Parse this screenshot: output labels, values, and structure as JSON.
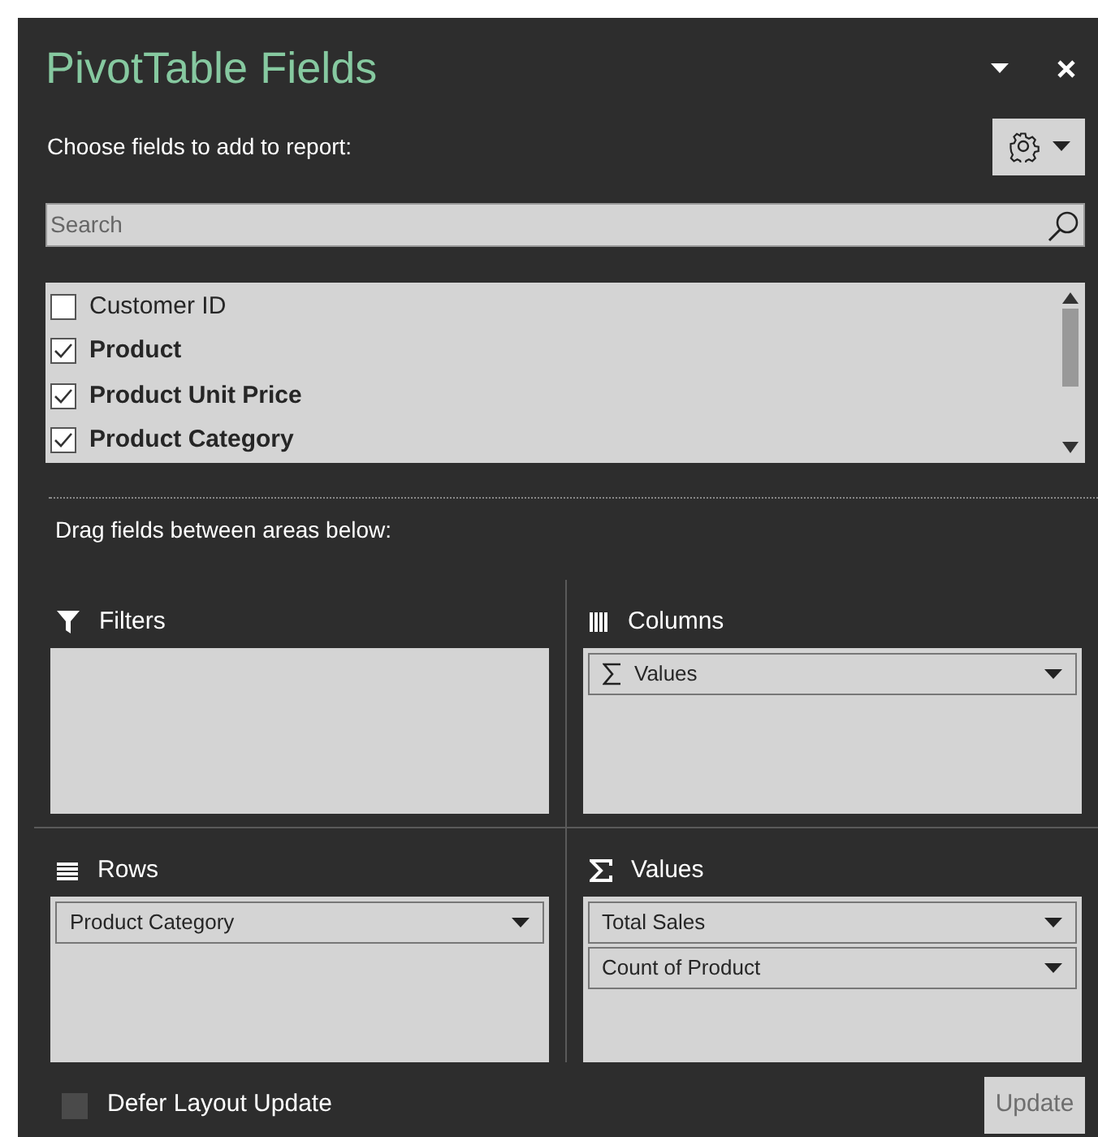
{
  "pane": {
    "title": "PivotTable Fields",
    "subtitle": "Choose fields to add to report:"
  },
  "search": {
    "placeholder": "Search"
  },
  "fields": [
    {
      "label": "Customer ID",
      "checked": false
    },
    {
      "label": "Product",
      "checked": true
    },
    {
      "label": "Product Unit Price",
      "checked": true
    },
    {
      "label": "Product Category",
      "checked": true
    }
  ],
  "areas_caption": "Drag fields between areas below:",
  "areas": [
    {
      "kind": "filters",
      "label": "Filters"
    },
    {
      "kind": "columns",
      "label": "Columns",
      "items": [
        {
          "kind": "sigma",
          "label": "Values"
        }
      ]
    },
    {
      "kind": "rows",
      "label": "Rows",
      "items": [
        {
          "kind": "plain",
          "label": "Product Category"
        }
      ]
    },
    {
      "kind": "values",
      "label": "Values",
      "items": [
        {
          "kind": "plain",
          "label": "Total Sales"
        },
        {
          "kind": "plain",
          "label": "Count of Product"
        }
      ]
    }
  ],
  "defer": {
    "label": "Defer Layout Update",
    "checked": false
  },
  "update_button": {
    "label": "Update",
    "disabled": true
  }
}
